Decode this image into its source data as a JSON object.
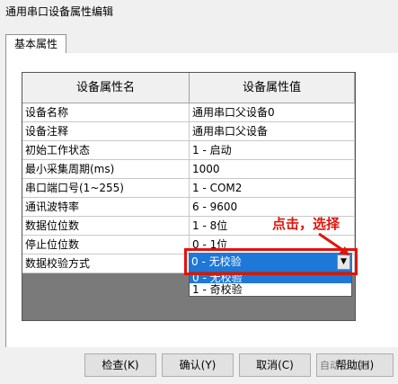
{
  "window": {
    "title": "通用串口设备属性编辑"
  },
  "tabs": [
    {
      "label": "基本属性"
    }
  ],
  "grid": {
    "headers": [
      "设备属性名",
      "设备属性值"
    ],
    "rows": [
      {
        "name": "设备名称",
        "value": "通用串口父设备0"
      },
      {
        "name": "设备注释",
        "value": "通用串口父设备"
      },
      {
        "name": "初始工作状态",
        "value": "1 - 启动"
      },
      {
        "name": "最小采集周期(ms)",
        "value": "1000"
      },
      {
        "name": "串口端口号(1~255)",
        "value": "1 - COM2"
      },
      {
        "name": "通讯波特率",
        "value": "6 - 9600"
      },
      {
        "name": "数据位位数",
        "value": "1 - 8位"
      },
      {
        "name": "停止位位数",
        "value": "0 - 1位"
      },
      {
        "name": "数据校验方式",
        "value": ""
      }
    ]
  },
  "parity_combo": {
    "selected": "0 - 无校验",
    "options": [
      "0 - 无校验",
      "1 - 奇校验"
    ]
  },
  "annotation": {
    "text": "点击，选择",
    "color": "#e0140a"
  },
  "buttons": {
    "check": "检查(K)",
    "confirm": "确认(Y)",
    "cancel": "取消(C)",
    "help": "帮助(H)"
  },
  "watermark": "自动化工控",
  "colors": {
    "selection": "#1e78d7",
    "highlight": "#e0140a"
  }
}
